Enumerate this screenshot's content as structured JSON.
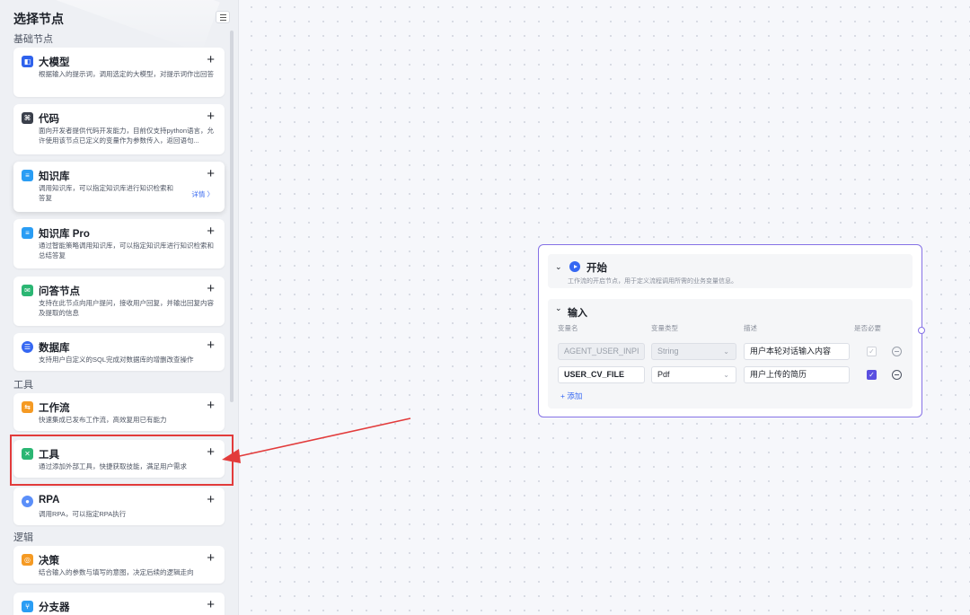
{
  "sidebar": {
    "title": "选择节点",
    "sections": {
      "basic": "基础节点",
      "tools": "工具",
      "logic": "逻辑"
    },
    "cards": [
      {
        "title": "大模型",
        "desc": "根据输入的提示词，调用选定的大模型，对提示词作出回答",
        "icon": "llm-icon",
        "color": "#2f62ec"
      },
      {
        "title": "代码",
        "desc": "面向开发者提供代码开发能力，目前仅支持python语言，允许使用该节点已定义的变量作为参数传入，返回语句...",
        "icon": "code-icon",
        "color": "#3a3f4b"
      },
      {
        "title": "知识库",
        "desc": "调用知识库，可以指定知识库进行知识检索和答复",
        "detail": "详情 〉",
        "icon": "knowledge-icon",
        "color": "#2a9df4"
      },
      {
        "title": "知识库 Pro",
        "desc": "通过智能策略调用知识库，可以指定知识库进行知识检索和总结答复",
        "icon": "knowledge-pro-icon",
        "color": "#2a9df4"
      },
      {
        "title": "问答节点",
        "desc": "支持在此节点向用户提问，接收用户回复，并输出回复内容及提取的信息",
        "icon": "qa-icon",
        "color": "#2bb673"
      },
      {
        "title": "数据库",
        "desc": "支持用户自定义的SQL完成对数据库的增删改查操作",
        "icon": "database-icon",
        "color": "#3567f2"
      },
      {
        "title": "工作流",
        "desc": "快速集成已发布工作流，高效复用已有能力",
        "icon": "workflow-icon",
        "color": "#f59a23"
      },
      {
        "title": "工具",
        "desc": "通过添加外部工具，快捷获取技能，满足用户需求",
        "icon": "tool-icon",
        "color": "#2bb673"
      },
      {
        "title": "RPA",
        "desc": "调用RPA，可以指定RPA执行",
        "icon": "rpa-icon",
        "color": "#5b8ff9"
      },
      {
        "title": "决策",
        "desc": "结合输入的参数与填写的意图，决定后续的逻辑走向",
        "icon": "decision-icon",
        "color": "#f59a23"
      },
      {
        "title": "分支器",
        "desc": "",
        "icon": "branch-icon",
        "color": "#2a9df4"
      }
    ]
  },
  "node": {
    "title": "开始",
    "desc": "工作流的开启节点，用于定义流程调用所需的业务变量信息。",
    "input_section": "输入",
    "columns": [
      "变量名",
      "变量类型",
      "描述",
      "是否必要"
    ],
    "rows": [
      {
        "name": "AGENT_USER_INPI",
        "type": "String",
        "desc": "用户本轮对话输入内容",
        "required": true,
        "disabled": true
      },
      {
        "name": "USER_CV_FILE",
        "type": "Pdf",
        "desc": "用户上传的简历",
        "required": true,
        "disabled": false
      }
    ],
    "add_label": "添加"
  },
  "colors": {
    "accent": "#3567f2",
    "node_border": "#8571e6",
    "highlight": "#e23b3b"
  }
}
